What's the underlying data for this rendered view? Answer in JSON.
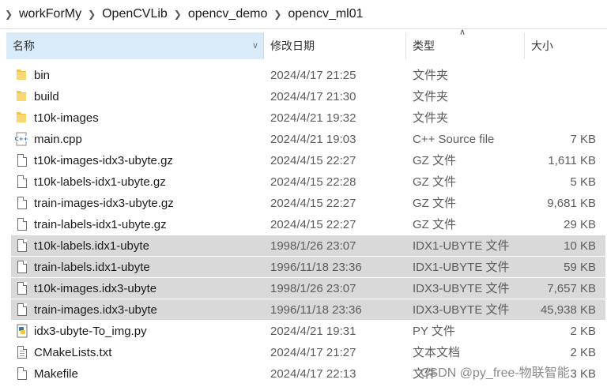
{
  "breadcrumb": [
    "workForMy",
    "OpenCVLib",
    "opencv_demo",
    "opencv_ml01"
  ],
  "columns": {
    "name": "名称",
    "date": "修改日期",
    "type": "类型",
    "size": "大小"
  },
  "files": [
    {
      "name": "bin",
      "date": "2024/4/17 21:25",
      "type": "文件夹",
      "size": "",
      "icon": "folder-icon",
      "selected": false
    },
    {
      "name": "build",
      "date": "2024/4/17 21:30",
      "type": "文件夹",
      "size": "",
      "icon": "folder-icon",
      "selected": false
    },
    {
      "name": "t10k-images",
      "date": "2024/4/21 19:32",
      "type": "文件夹",
      "size": "",
      "icon": "folder-icon",
      "selected": false
    },
    {
      "name": "main.cpp",
      "date": "2024/4/21 19:03",
      "type": "C++ Source file",
      "size": "7 KB",
      "icon": "cpp-file-icon",
      "selected": false
    },
    {
      "name": "t10k-images-idx3-ubyte.gz",
      "date": "2024/4/15 22:27",
      "type": "GZ 文件",
      "size": "1,611 KB",
      "icon": "file-icon",
      "selected": false
    },
    {
      "name": "t10k-labels-idx1-ubyte.gz",
      "date": "2024/4/15 22:28",
      "type": "GZ 文件",
      "size": "5 KB",
      "icon": "file-icon",
      "selected": false
    },
    {
      "name": "train-images-idx3-ubyte.gz",
      "date": "2024/4/15 22:27",
      "type": "GZ 文件",
      "size": "9,681 KB",
      "icon": "file-icon",
      "selected": false
    },
    {
      "name": "train-labels-idx1-ubyte.gz",
      "date": "2024/4/15 22:27",
      "type": "GZ 文件",
      "size": "29 KB",
      "icon": "file-icon",
      "selected": false
    },
    {
      "name": "t10k-labels.idx1-ubyte",
      "date": "1998/1/26 23:07",
      "type": "IDX1-UBYTE 文件",
      "size": "10 KB",
      "icon": "file-icon",
      "selected": true
    },
    {
      "name": "train-labels.idx1-ubyte",
      "date": "1996/11/18 23:36",
      "type": "IDX1-UBYTE 文件",
      "size": "59 KB",
      "icon": "file-icon",
      "selected": true
    },
    {
      "name": "t10k-images.idx3-ubyte",
      "date": "1998/1/26 23:07",
      "type": "IDX3-UBYTE 文件",
      "size": "7,657 KB",
      "icon": "file-icon",
      "selected": true
    },
    {
      "name": "train-images.idx3-ubyte",
      "date": "1996/11/18 23:36",
      "type": "IDX3-UBYTE 文件",
      "size": "45,938 KB",
      "icon": "file-icon",
      "selected": true
    },
    {
      "name": "idx3-ubyte-To_img.py",
      "date": "2024/4/21 19:31",
      "type": "PY 文件",
      "size": "2 KB",
      "icon": "python-file-icon",
      "selected": false
    },
    {
      "name": "CMakeLists.txt",
      "date": "2024/4/17 21:27",
      "type": "文本文档",
      "size": "2 KB",
      "icon": "text-file-icon",
      "selected": false
    },
    {
      "name": "Makefile",
      "date": "2024/4/17 22:13",
      "type": "文件",
      "size": "3 KB",
      "icon": "file-icon",
      "selected": false
    }
  ],
  "watermark": "CSDN @py_free-物联智能",
  "colors": {
    "header_active": "#d9ebf9",
    "selection": "#d9d9d9",
    "folder": "#f3c343"
  }
}
